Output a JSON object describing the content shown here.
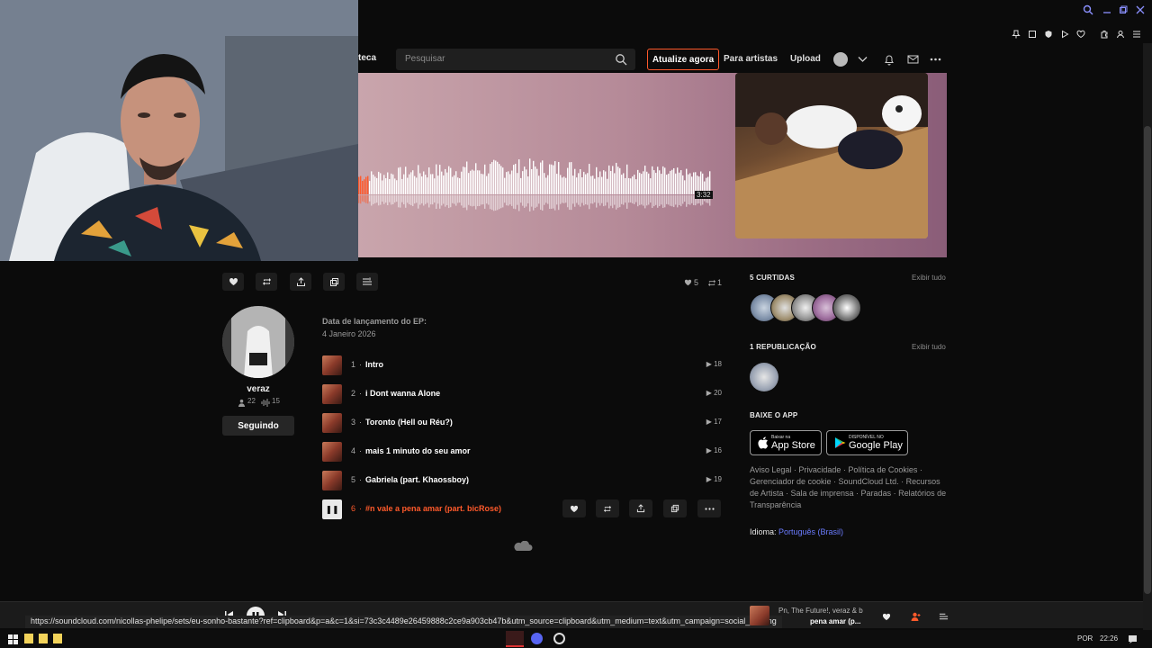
{
  "header": {
    "library_label": "teca",
    "search_placeholder": "Pesquisar",
    "upgrade_label": "Atualize agora",
    "for_artists_label": "Para artistas",
    "upload_label": "Upload"
  },
  "hero": {
    "duration": "3:32",
    "progress_fraction": 0.03
  },
  "actions": {
    "like_count": "5",
    "repost_count": "1"
  },
  "artist": {
    "name": "veraz",
    "followers": "22",
    "tracks": "15",
    "follow_label": "Seguindo"
  },
  "release": {
    "label": "Data de lançamento do EP:",
    "date": "4 Janeiro 2026"
  },
  "tracks": [
    {
      "num": "1",
      "title": "Intro",
      "plays": "18"
    },
    {
      "num": "2",
      "title": "i Dont wanna Alone",
      "plays": "20"
    },
    {
      "num": "3",
      "title": "Toronto (Hell ou Réu?)",
      "plays": "17"
    },
    {
      "num": "4",
      "title": "mais 1 minuto do seu amor",
      "plays": "16"
    },
    {
      "num": "5",
      "title": "Gabriela (part. Khaossboy)",
      "plays": "19"
    },
    {
      "num": "6",
      "title": "#n vale a pena amar (part. bicRose)",
      "plays": ""
    }
  ],
  "sidebar": {
    "likes_title": "5 CURTIDAS",
    "reposts_title": "1 REPUBLICAÇÃO",
    "view_all": "Exibir tudo",
    "app_title": "BAIXE O APP",
    "appstore_small": "Baixar na",
    "appstore_large": "App Store",
    "play_small": "DISPONÍVEL NO",
    "play_large": "Google Play",
    "legal": "Aviso Legal · Privacidade · Política de Cookies · Gerenciador de cookie · SoundCloud Ltd. · Recursos de Artista · Sala de imprensa · Paradas · Relatórios de Transparência",
    "language_label": "Idioma:",
    "language_value": "Português (Brasil)"
  },
  "player": {
    "url": "https://soundcloud.com/nicollas-phelipe/sets/eu-sonho-bastante?ref=clipboard&p=a&c=1&si=73c3c4489e26459888c2ce9a903cb47b&utm_source=clipboard&utm_medium=text&utm_campaign=social_sharing",
    "now_artist": "Pn, The Future!, veraz & b",
    "now_title": "pena amar (p..."
  },
  "taskbar": {
    "lang": "POR",
    "time": "22:26"
  },
  "colors": {
    "accent": "#ff5a2b",
    "link": "#6b7cff"
  }
}
